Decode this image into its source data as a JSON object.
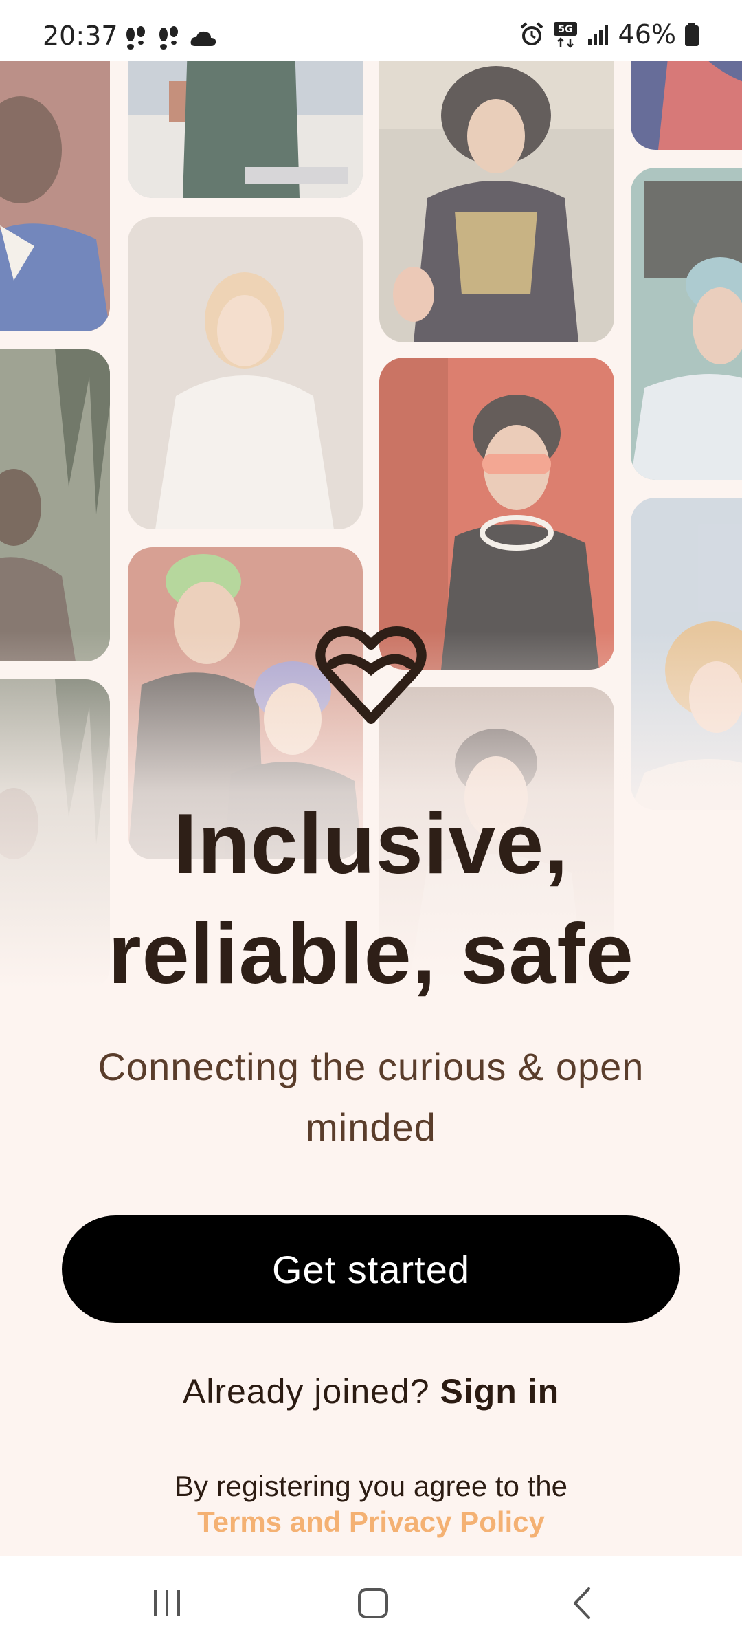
{
  "status_bar": {
    "time": "20:37",
    "battery_percent": "46%",
    "network": "5G",
    "left_icons": [
      "footsteps-icon",
      "footsteps-icon",
      "cloud-icon"
    ],
    "right_icons": [
      "alarm-icon",
      "5g-data-icon",
      "signal-icon",
      "battery-icon"
    ]
  },
  "hero": {
    "logo_icon": "heart-logo-icon",
    "headline_line1": "Inclusive,",
    "headline_line2": "reliable, safe",
    "subheadline": "Connecting the curious & open minded"
  },
  "actions": {
    "get_started_label": "Get started",
    "already_joined_text": "Already joined?",
    "sign_in_label": "Sign in"
  },
  "legal": {
    "agreement_text": "By registering you agree to the",
    "terms_link_label": "Terms and Privacy Policy"
  },
  "nav_bar": {
    "recent_apps_icon": "recent-apps-icon",
    "home_icon": "home-icon",
    "back_icon": "back-icon"
  },
  "colors": {
    "background": "#fdf4f0",
    "headline": "#2e1f17",
    "button": "#000000",
    "link_accent": "#f4b173"
  }
}
